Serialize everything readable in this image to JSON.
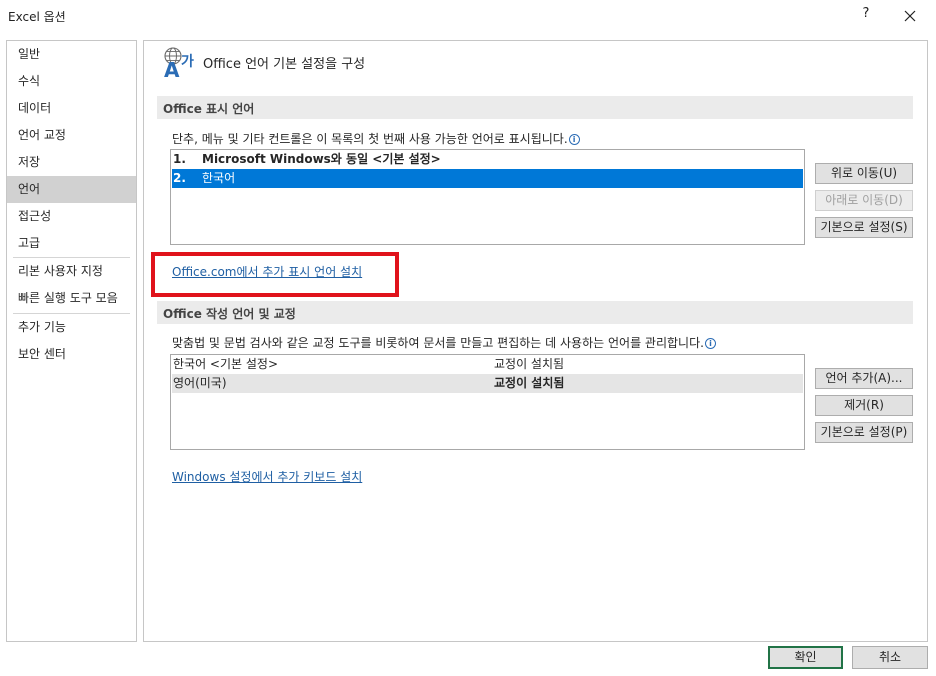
{
  "window": {
    "title": "Excel 옵션",
    "help_label": "?"
  },
  "sidebar": {
    "items": [
      {
        "label": "일반"
      },
      {
        "label": "수식"
      },
      {
        "label": "데이터"
      },
      {
        "label": "언어 교정"
      },
      {
        "label": "저장"
      },
      {
        "label": "언어",
        "selected": true
      },
      {
        "label": "접근성"
      },
      {
        "label": "고급"
      },
      {
        "label": "리본 사용자 지정"
      },
      {
        "label": "빠른 실행 도구 모음"
      },
      {
        "label": "추가 기능"
      },
      {
        "label": "보안 센터"
      }
    ]
  },
  "header": {
    "title": "Office 언어 기본 설정을 구성",
    "icon": "language-icon"
  },
  "display_language": {
    "section_title": "Office 표시 언어",
    "description": "단추, 메뉴 및 기타 컨트롤은 이 목록의 첫 번째 사용 가능한 언어로 표시됩니다.",
    "items": [
      {
        "num": "1.",
        "label": "Microsoft Windows와 동일 <기본 설정>"
      },
      {
        "num": "2.",
        "label": "한국어",
        "selected": true
      }
    ],
    "buttons": {
      "move_up": "위로 이동(U)",
      "move_down": "아래로 이동(D)",
      "set_default": "기본으로 설정(S)"
    },
    "link": "Office.com에서 추가 표시 언어 설치"
  },
  "authoring_language": {
    "section_title": "Office 작성 언어 및 교정",
    "description": "맞춤법 및 문법 검사와 같은 교정 도구를 비롯하여 문서를 만들고 편집하는 데 사용하는 언어를 관리합니다.",
    "rows": [
      {
        "language": "한국어 <기본 설정>",
        "status": "교정이 설치됨"
      },
      {
        "language": "영어(미국)",
        "status": "교정이 설치됨",
        "selected": true
      }
    ],
    "buttons": {
      "add": "언어 추가(A)...",
      "remove": "제거(R)",
      "set_default": "기본으로 설정(P)"
    },
    "link": "Windows 설정에서 추가 키보드 설치"
  },
  "footer": {
    "ok": "확인",
    "cancel": "취소"
  },
  "colors": {
    "selection": "#0078d7",
    "highlight_box": "#e0121b",
    "link": "#1f5fa3",
    "ok_border": "#217346"
  }
}
